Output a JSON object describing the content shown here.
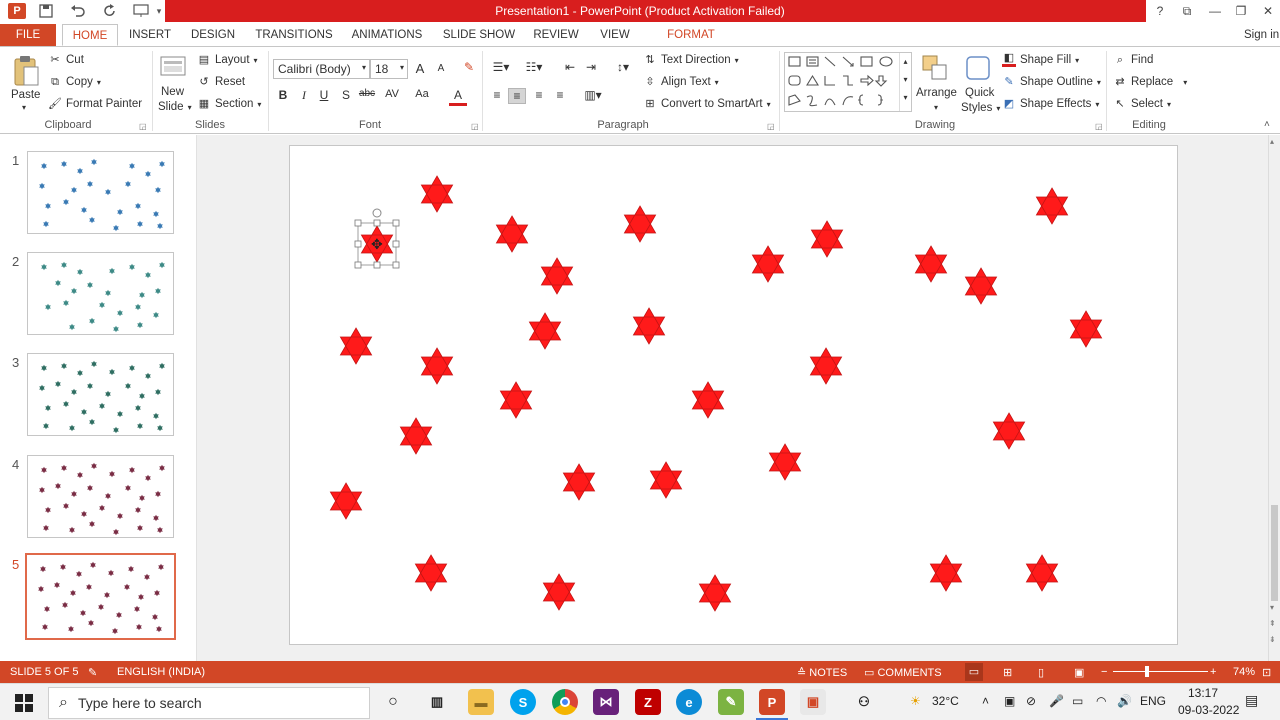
{
  "app": {
    "title": "Presentation1  -  PowerPoint (Product Activation Failed)",
    "app_icon": "P",
    "signin": "Sign in"
  },
  "window_controls": {
    "help": "?",
    "ribbon_options": "⧉",
    "minimize": "—",
    "restore": "❐",
    "close": "✕"
  },
  "tabs": [
    "FILE",
    "HOME",
    "INSERT",
    "DESIGN",
    "TRANSITIONS",
    "ANIMATIONS",
    "SLIDE SHOW",
    "REVIEW",
    "VIEW",
    "FORMAT"
  ],
  "ribbon": {
    "clipboard": {
      "paste": "Paste",
      "cut": "Cut",
      "copy": "Copy",
      "format_painter": "Format Painter",
      "label": "Clipboard"
    },
    "slides": {
      "new_slide_1": "New",
      "new_slide_2": "Slide",
      "layout": "Layout",
      "reset": "Reset",
      "section": "Section",
      "label": "Slides"
    },
    "font": {
      "font_name": "Calibri (Body)",
      "font_size": "18",
      "bold": "B",
      "italic": "I",
      "underline": "U",
      "shadow": "S",
      "strike": "abc",
      "spacing": "AV",
      "case": "Aa",
      "color": "A",
      "grow": "A",
      "shrink": "A",
      "label": "Font"
    },
    "paragraph": {
      "text_direction": "Text Direction",
      "align_text": "Align Text",
      "convert_smartart": "Convert to SmartArt",
      "label": "Paragraph"
    },
    "drawing": {
      "arrange": "Arrange",
      "quick_styles_1": "Quick",
      "quick_styles_2": "Styles",
      "shape_fill": "Shape Fill",
      "shape_outline": "Shape Outline",
      "shape_effects": "Shape Effects",
      "label": "Drawing"
    },
    "editing": {
      "find": "Find",
      "replace": "Replace",
      "select": "Select",
      "label": "Editing"
    }
  },
  "thumbnails": [
    {
      "num": "1",
      "color": "#3a7ab4"
    },
    {
      "num": "2",
      "color": "#3e8a86"
    },
    {
      "num": "3",
      "color": "#2f6e62"
    },
    {
      "num": "4",
      "color": "#7a2d45"
    },
    {
      "num": "5",
      "color": "#7a2d45"
    }
  ],
  "slide": {
    "star_color": "#ff1a1a",
    "selected_star_index": 0
  },
  "status": {
    "slide_of": "SLIDE 5 OF 5",
    "language": "ENGLISH (INDIA)",
    "notes": "NOTES",
    "comments": "COMMENTS",
    "zoom": "74%",
    "zoom_minus": "−",
    "zoom_plus": "+"
  },
  "taskbar": {
    "search_placeholder": "Type here to search",
    "weather": "32°C",
    "language": "ENG",
    "time": "13:17",
    "date": "09-03-2022"
  }
}
